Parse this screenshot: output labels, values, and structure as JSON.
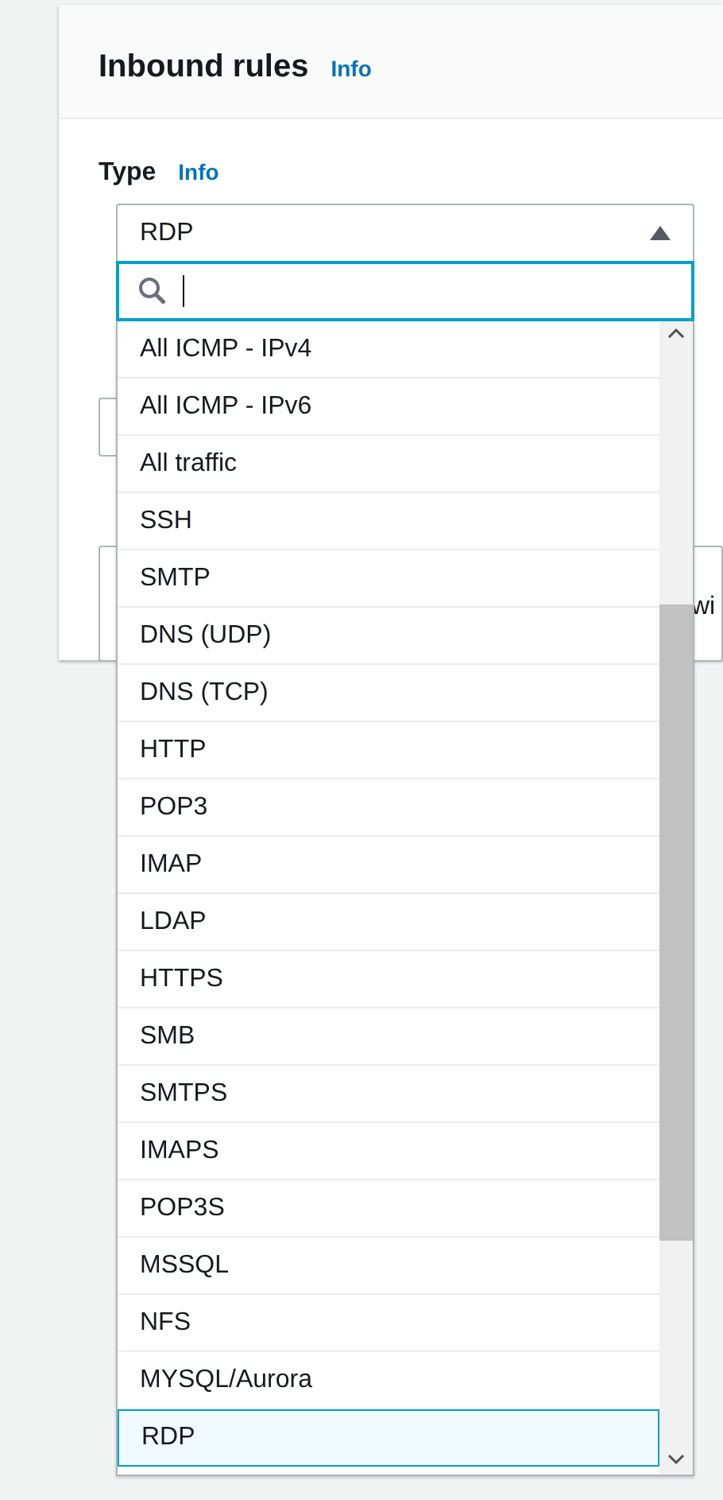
{
  "panel": {
    "title": "Inbound rules",
    "info_link": "Info"
  },
  "type_field": {
    "label": "Type",
    "info_link": "Info",
    "value": "RDP",
    "expanded": true
  },
  "behind_text": "wi",
  "options": [
    {
      "label": "All ICMP - IPv4",
      "selected": false
    },
    {
      "label": "All ICMP - IPv6",
      "selected": false
    },
    {
      "label": "All traffic",
      "selected": false
    },
    {
      "label": "SSH",
      "selected": false
    },
    {
      "label": "SMTP",
      "selected": false
    },
    {
      "label": "DNS (UDP)",
      "selected": false
    },
    {
      "label": "DNS (TCP)",
      "selected": false
    },
    {
      "label": "HTTP",
      "selected": false
    },
    {
      "label": "POP3",
      "selected": false
    },
    {
      "label": "IMAP",
      "selected": false
    },
    {
      "label": "LDAP",
      "selected": false
    },
    {
      "label": "HTTPS",
      "selected": false
    },
    {
      "label": "SMB",
      "selected": false
    },
    {
      "label": "SMTPS",
      "selected": false
    },
    {
      "label": "IMAPS",
      "selected": false
    },
    {
      "label": "POP3S",
      "selected": false
    },
    {
      "label": "MSSQL",
      "selected": false
    },
    {
      "label": "NFS",
      "selected": false
    },
    {
      "label": "MYSQL/Aurora",
      "selected": false
    },
    {
      "label": "RDP",
      "selected": true
    }
  ]
}
